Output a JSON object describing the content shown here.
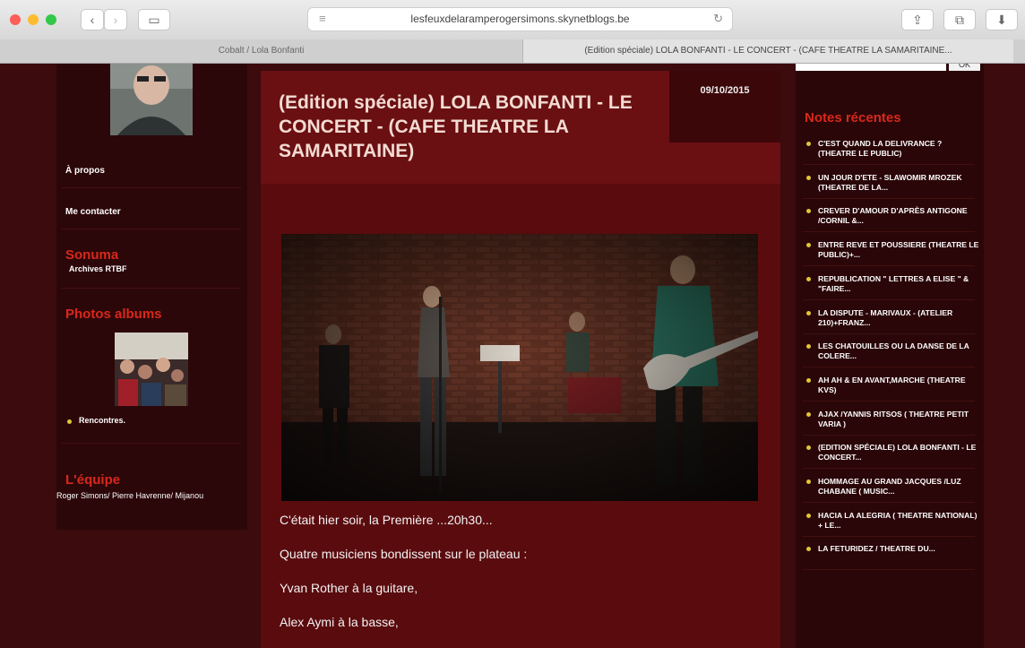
{
  "browser": {
    "url": "lesfeuxdelaramperogersimons.skynetblogs.be",
    "tabs": [
      "Cobalt / Lola Bonfanti",
      "(Edition spéciale) LOLA BONFANTI - LE CONCERT - (CAFE THEATRE LA SAMARITAINE..."
    ],
    "traffic_colors": [
      "#fc5f57",
      "#fdbc2e",
      "#34c84a"
    ]
  },
  "sidebar": {
    "links": [
      "À propos",
      "Me contacter"
    ],
    "sonuma": {
      "title": "Sonuma",
      "sub": "Archives RTBF"
    },
    "albums": {
      "title": "Photos albums",
      "items": [
        "Rencontres."
      ]
    },
    "team": {
      "title": "L'équipe",
      "members": "Roger Simons/ Pierre Havrenne/ Mijanou"
    }
  },
  "post": {
    "title": "(Edition spéciale) LOLA BONFANTI - LE CONCERT - (CAFE THEATRE LA SAMARITAINE)",
    "date": "09/10/2015",
    "paragraphs": [
      "C'était hier soir, la Première ...20h30...",
      "Quatre musiciens bondissent sur le plateau :",
      "Yvan Rother à la guitare,",
      "Alex Aymi à la basse,"
    ]
  },
  "notes": {
    "title": "Notes récentes",
    "search_button": "OK",
    "items": [
      "C'EST QUAND LA DELIVRANCE ? (THEATRE LE PUBLIC)",
      "UN JOUR D'ETE - SLAWOMIR MROZEK (THEATRE DE LA...",
      "CREVER D'AMOUR d'après ANTIGONE /CORNIL &...",
      "ENTRE REVE ET POUSSIERE (THEATRE LE PUBLIC)+...",
      "REPUBLICATION \" LETTRES A ELISE \" & \"FAIRE...",
      "LA DISPUTE - MARIVAUX - (ATELIER 210)+FRANZ...",
      "LES CHATOUILLES OU LA DANSE DE LA COLERE...",
      "AH AH & EN AVANT,MARCHE (THEATRE KVS)",
      "AJAX /YANNIS RITSOS ( THEATRE PETIT VARIA )",
      "(Edition spéciale) LOLA BONFANTI - LE CONCERT...",
      "HOMMAGE AU GRAND JACQUES /LUZ CHABANE ( MUSIC...",
      "HACIA LA ALEGRIA ( THEATRE NATIONAL) + LE...",
      "LA FETURIDEZ / THEATRE DU..."
    ]
  }
}
